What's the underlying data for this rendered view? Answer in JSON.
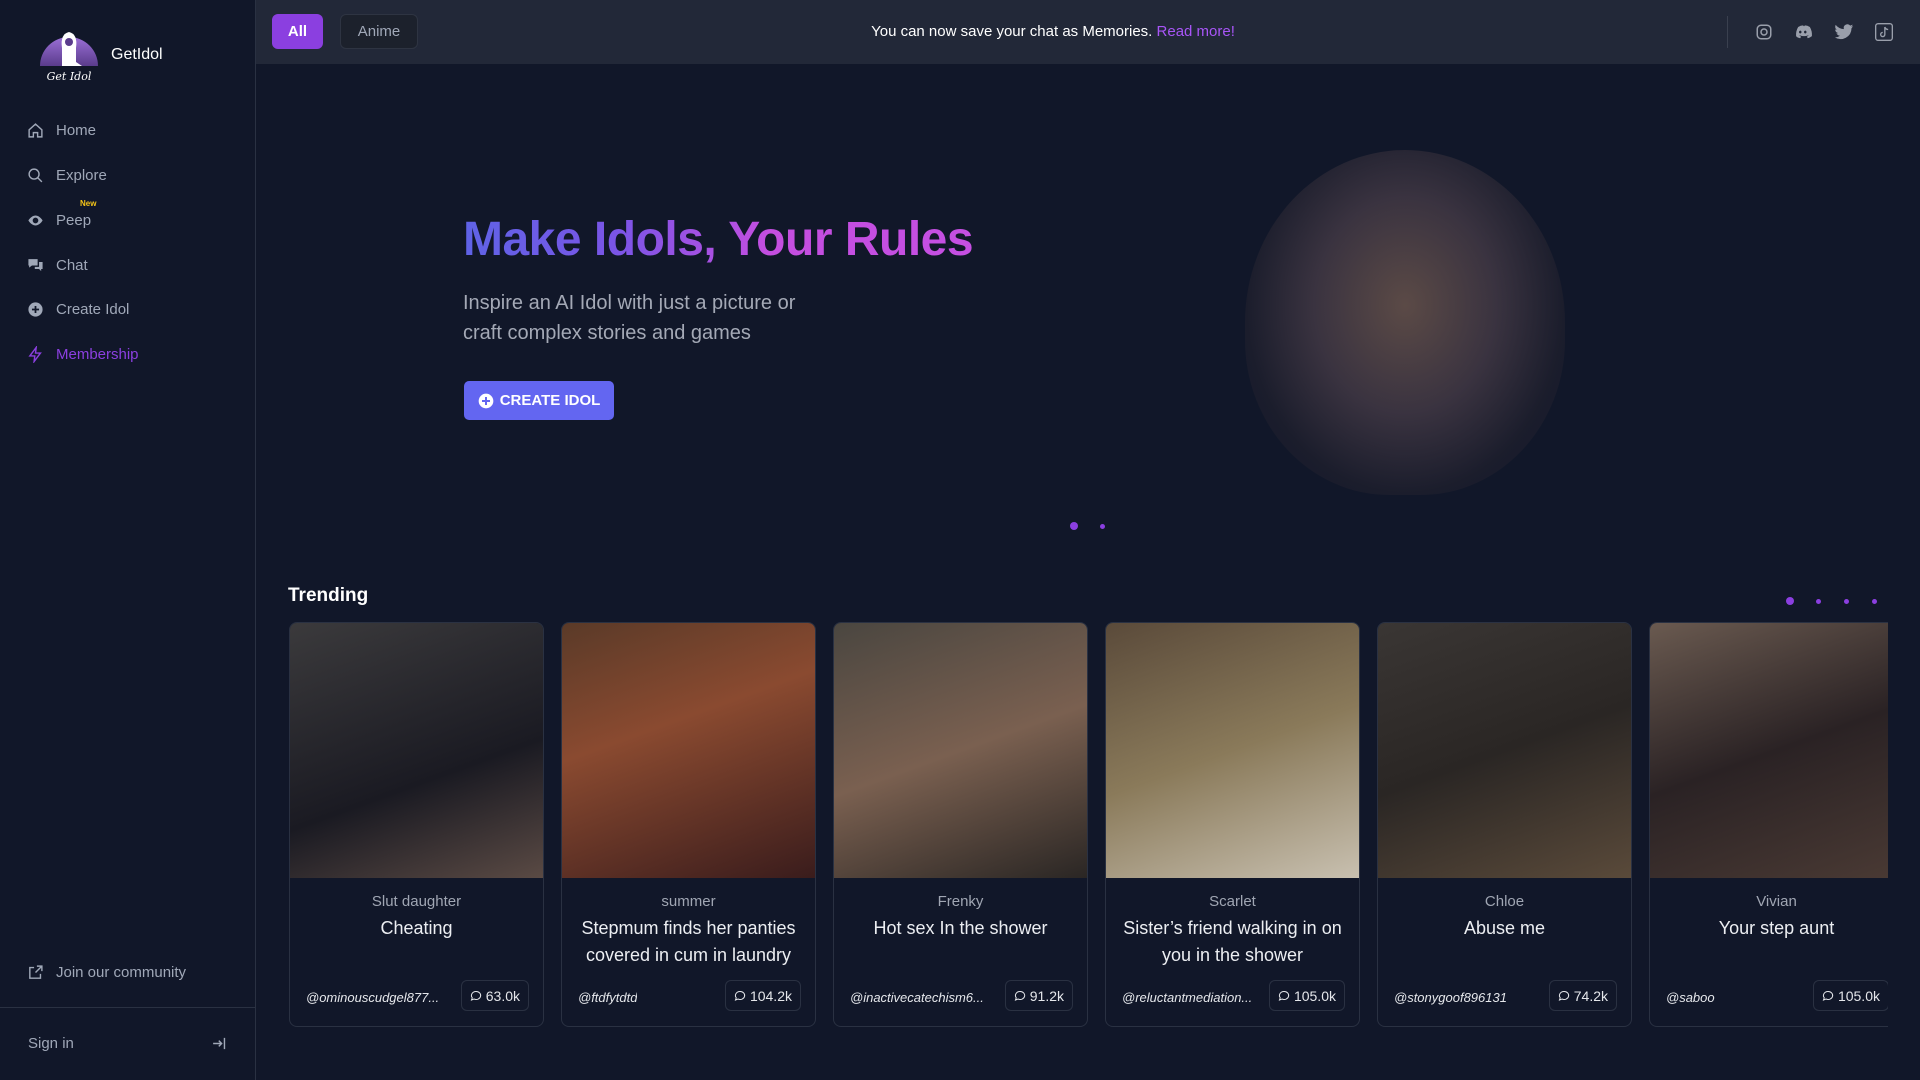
{
  "brand": {
    "name": "GetIdol",
    "logo_text": "Get Idol"
  },
  "sidebar": {
    "items": [
      {
        "label": "Home",
        "icon": "home-icon"
      },
      {
        "label": "Explore",
        "icon": "search-icon"
      },
      {
        "label": "Peep",
        "icon": "eye-icon",
        "badge": "New"
      },
      {
        "label": "Chat",
        "icon": "chat-icon"
      },
      {
        "label": "Create Idol",
        "icon": "plus-circle-icon"
      },
      {
        "label": "Membership",
        "icon": "lightning-icon",
        "active": true
      }
    ],
    "community": "Join our community",
    "sign_in": "Sign in"
  },
  "header": {
    "tabs": [
      {
        "label": "All",
        "active": true
      },
      {
        "label": "Anime"
      }
    ],
    "announcement": "You can now save your chat as Memories.",
    "announcement_link": "Read more!",
    "social": [
      "instagram-icon",
      "discord-icon",
      "twitter-icon",
      "tiktok-icon"
    ]
  },
  "hero": {
    "title": "Make Idols, Your Rules",
    "subtitle": "Inspire an AI Idol with just a picture or craft complex stories and games",
    "button": "CREATE IDOL",
    "slides": 2,
    "active_slide": 1
  },
  "trending": {
    "title": "Trending",
    "pages": 4,
    "active_page": 1,
    "cards": [
      {
        "name": "Slut daughter",
        "title": "Cheating",
        "user": "@ominouscudgel877...",
        "count": "63.0k"
      },
      {
        "name": "summer",
        "title": "Stepmum finds her panties covered in cum in laundry",
        "user": "@ftdfytdtd",
        "count": "104.2k"
      },
      {
        "name": "Frenky",
        "title": "Hot sex In the shower",
        "user": "@inactivecatechism6...",
        "count": "91.2k"
      },
      {
        "name": "Scarlet",
        "title": "Sister’s friend walking in on you in the shower",
        "user": "@reluctantmediation...",
        "count": "105.0k"
      },
      {
        "name": "Chloe",
        "title": "Abuse me",
        "user": "@stonygoof896131",
        "count": "74.2k"
      },
      {
        "name": "Vivian",
        "title": "Your step aunt",
        "user": "@saboo",
        "count": "105.0k"
      }
    ]
  },
  "colors": {
    "accent": "#8b3fe0",
    "button": "#6366f1",
    "bg": "#111729",
    "header": "#222838"
  }
}
